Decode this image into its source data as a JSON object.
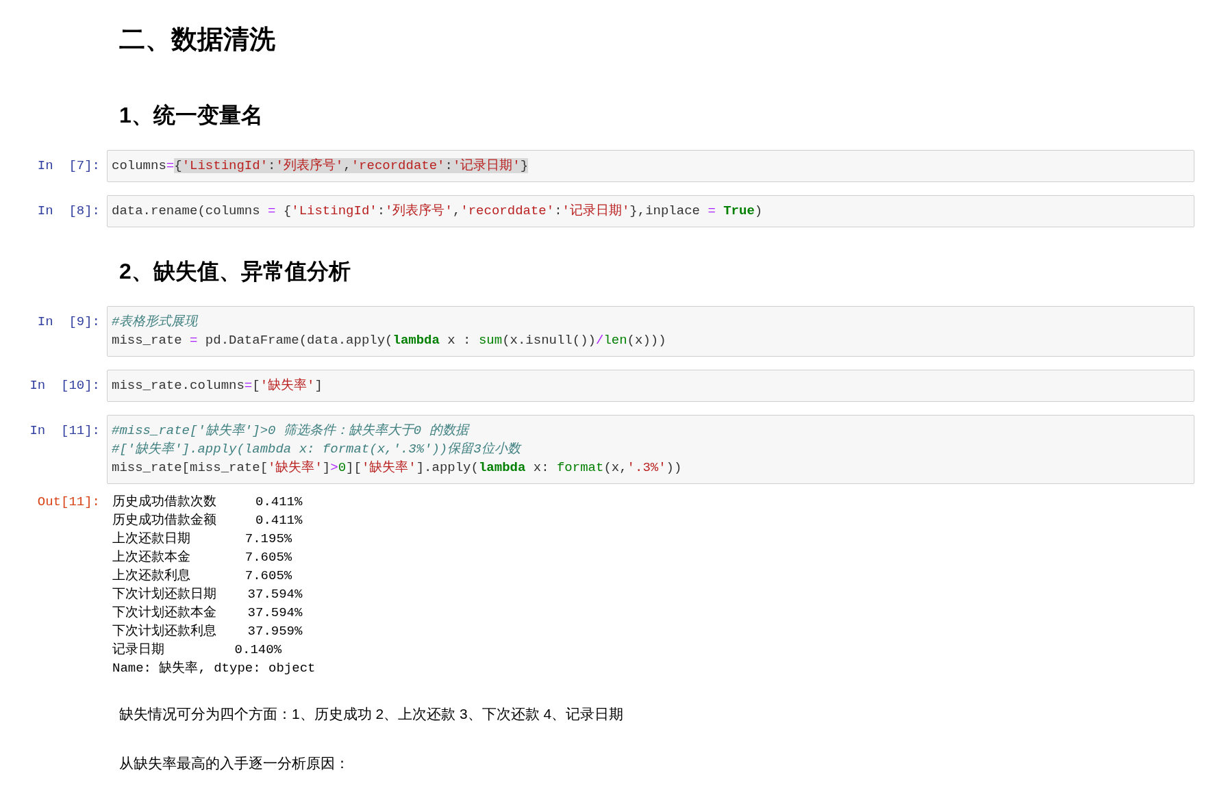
{
  "cells": [
    {
      "kind": "title",
      "text": "二、数据清洗"
    },
    {
      "kind": "heading",
      "text": "1、统一变量名"
    },
    {
      "kind": "code",
      "prompt": "In  [7]:",
      "lines": [
        [
          {
            "t": "columns",
            "kind": "plain",
            "highlighted": false
          },
          {
            "t": "=",
            "kind": "op",
            "highlighted": false
          },
          {
            "t": "{",
            "kind": "plain",
            "highlighted": true
          },
          {
            "t": "'ListingId'",
            "kind": "str",
            "highlighted": true
          },
          {
            "t": ":",
            "kind": "plain",
            "highlighted": true
          },
          {
            "t": "'列表序号'",
            "kind": "str",
            "highlighted": true
          },
          {
            "t": ",",
            "kind": "plain",
            "highlighted": true
          },
          {
            "t": "'recorddate'",
            "kind": "str",
            "highlighted": true
          },
          {
            "t": ":",
            "kind": "plain",
            "highlighted": true
          },
          {
            "t": "'记录日期'",
            "kind": "str",
            "highlighted": true
          },
          {
            "t": "}",
            "kind": "plain",
            "highlighted": true
          }
        ]
      ]
    },
    {
      "kind": "code",
      "prompt": "In  [8]:",
      "lines": [
        [
          {
            "t": "data.rename(columns ",
            "kind": "plain"
          },
          {
            "t": "=",
            "kind": "op"
          },
          {
            "t": " {",
            "kind": "plain"
          },
          {
            "t": "'ListingId'",
            "kind": "str"
          },
          {
            "t": ":",
            "kind": "plain"
          },
          {
            "t": "'列表序号'",
            "kind": "str"
          },
          {
            "t": ",",
            "kind": "plain"
          },
          {
            "t": "'recorddate'",
            "kind": "str"
          },
          {
            "t": ":",
            "kind": "plain"
          },
          {
            "t": "'记录日期'",
            "kind": "str"
          },
          {
            "t": "},inplace ",
            "kind": "plain"
          },
          {
            "t": "=",
            "kind": "op"
          },
          {
            "t": " True",
            "kind": "kw"
          },
          {
            "t": ")",
            "kind": "plain"
          }
        ]
      ]
    },
    {
      "kind": "heading",
      "text": "2、缺失值、异常值分析"
    },
    {
      "kind": "code",
      "prompt": "In  [9]:",
      "lines": [
        [
          {
            "t": "#表格形式展现",
            "kind": "comment"
          }
        ],
        [
          {
            "t": "miss_rate ",
            "kind": "plain"
          },
          {
            "t": "=",
            "kind": "op"
          },
          {
            "t": " pd.DataFrame(data.apply(",
            "kind": "plain"
          },
          {
            "t": "lambda",
            "kind": "kw"
          },
          {
            "t": " x : ",
            "kind": "plain"
          },
          {
            "t": "sum",
            "kind": "builtin"
          },
          {
            "t": "(x.isnull())",
            "kind": "plain"
          },
          {
            "t": "/",
            "kind": "op"
          },
          {
            "t": "len",
            "kind": "builtin"
          },
          {
            "t": "(x)))",
            "kind": "plain"
          }
        ]
      ]
    },
    {
      "kind": "code",
      "prompt": "In  [10]:",
      "lines": [
        [
          {
            "t": "miss_rate.columns",
            "kind": "plain"
          },
          {
            "t": "=",
            "kind": "op"
          },
          {
            "t": "[",
            "kind": "plain"
          },
          {
            "t": "'缺失率'",
            "kind": "str"
          },
          {
            "t": "]",
            "kind": "plain"
          }
        ]
      ]
    },
    {
      "kind": "code",
      "prompt": "In  [11]:",
      "lines": [
        [
          {
            "t": "#miss_rate['缺失率']>0 筛选条件：缺失率大于0 的数据",
            "kind": "comment"
          }
        ],
        [
          {
            "t": "#['缺失率'].apply(lambda x: format(x,'.3%'))保留3位小数",
            "kind": "comment"
          }
        ],
        [
          {
            "t": "miss_rate[miss_rate[",
            "kind": "plain"
          },
          {
            "t": "'缺失率'",
            "kind": "str"
          },
          {
            "t": "]",
            "kind": "plain"
          },
          {
            "t": ">",
            "kind": "op"
          },
          {
            "t": "0",
            "kind": "num"
          },
          {
            "t": "][",
            "kind": "plain"
          },
          {
            "t": "'缺失率'",
            "kind": "str"
          },
          {
            "t": "].apply(",
            "kind": "plain"
          },
          {
            "t": "lambda",
            "kind": "kw"
          },
          {
            "t": " x: ",
            "kind": "plain"
          },
          {
            "t": "format",
            "kind": "builtin"
          },
          {
            "t": "(x,",
            "kind": "plain"
          },
          {
            "t": "'.3%'",
            "kind": "str"
          },
          {
            "t": "))",
            "kind": "plain"
          }
        ]
      ]
    },
    {
      "kind": "output",
      "prompt": "Out[11]:",
      "lines": [
        "历史成功借款次数     0.411%",
        "历史成功借款金额     0.411%",
        "上次还款日期       7.195%",
        "上次还款本金       7.605%",
        "上次还款利息       7.605%",
        "下次计划还款日期    37.594%",
        "下次计划还款本金    37.594%",
        "下次计划还款利息    37.959%",
        "记录日期         0.140%",
        "Name: 缺失率, dtype: object"
      ]
    },
    {
      "kind": "text",
      "text": "缺失情况可分为四个方面：1、历史成功 2、上次还款 3、下次还款 4、记录日期"
    },
    {
      "kind": "text",
      "text": "从缺失率最高的入手逐一分析原因："
    }
  ]
}
